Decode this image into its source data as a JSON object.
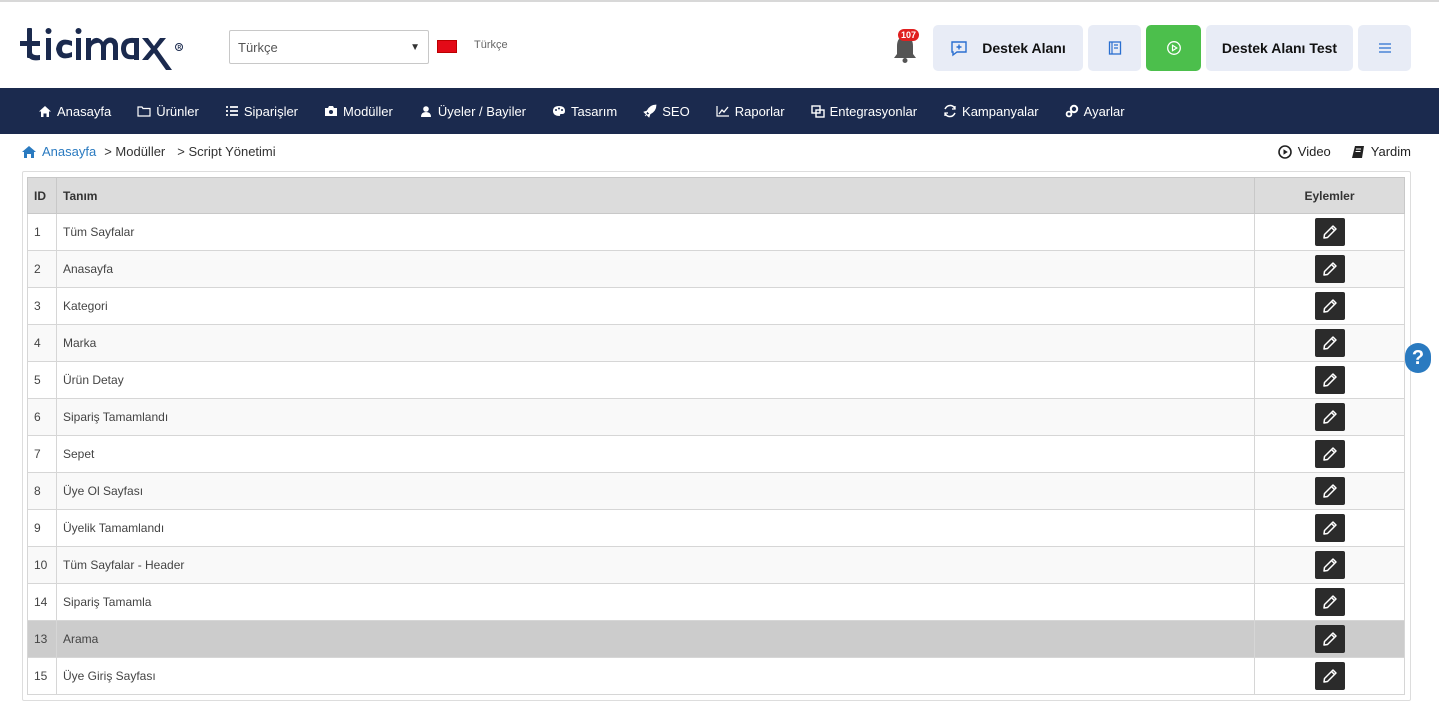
{
  "brand": {
    "logo_text": "ticimax",
    "accent": "#1b2a4e"
  },
  "header": {
    "language_select": {
      "value": "Türkçe"
    },
    "language_label": "Türkçe",
    "notification_count": "107",
    "support_button": "Destek Alanı",
    "store_button": "Destek Alanı Test"
  },
  "nav": {
    "items": [
      {
        "label": "Anasayfa",
        "icon": "home-icon"
      },
      {
        "label": "Ürünler",
        "icon": "folder-icon"
      },
      {
        "label": "Siparişler",
        "icon": "list-icon"
      },
      {
        "label": "Modüller",
        "icon": "box-icon"
      },
      {
        "label": "Üyeler / Bayiler",
        "icon": "users-icon"
      },
      {
        "label": "Tasarım",
        "icon": "palette-icon"
      },
      {
        "label": "SEO",
        "icon": "rocket-icon"
      },
      {
        "label": "Raporlar",
        "icon": "chart-icon"
      },
      {
        "label": "Entegrasyonlar",
        "icon": "link-icon"
      },
      {
        "label": "Kampanyalar",
        "icon": "refresh-icon"
      },
      {
        "label": "Ayarlar",
        "icon": "gears-icon"
      }
    ]
  },
  "breadcrumb": {
    "home": "Anasayfa",
    "items": [
      "> Modüller",
      "> Script Yönetimi"
    ]
  },
  "toplinks": {
    "video": "Video",
    "help": "Yardim"
  },
  "table": {
    "headers": {
      "id": "ID",
      "name": "Tanım",
      "actions": "Eylemler"
    },
    "rows": [
      {
        "id": "1",
        "name": "Tüm Sayfalar"
      },
      {
        "id": "2",
        "name": "Anasayfa"
      },
      {
        "id": "3",
        "name": "Kategori"
      },
      {
        "id": "4",
        "name": "Marka"
      },
      {
        "id": "5",
        "name": "Ürün Detay"
      },
      {
        "id": "6",
        "name": "Sipariş Tamamlandı"
      },
      {
        "id": "7",
        "name": "Sepet"
      },
      {
        "id": "8",
        "name": "Üye Ol Sayfası"
      },
      {
        "id": "9",
        "name": "Üyelik Tamamlandı"
      },
      {
        "id": "10",
        "name": "Tüm Sayfalar - Header"
      },
      {
        "id": "14",
        "name": "Sipariş Tamamla"
      },
      {
        "id": "13",
        "name": "Arama"
      },
      {
        "id": "15",
        "name": "Üye Giriş Sayfası"
      }
    ],
    "highlighted_row_index": 11
  },
  "help_bubble": "?"
}
